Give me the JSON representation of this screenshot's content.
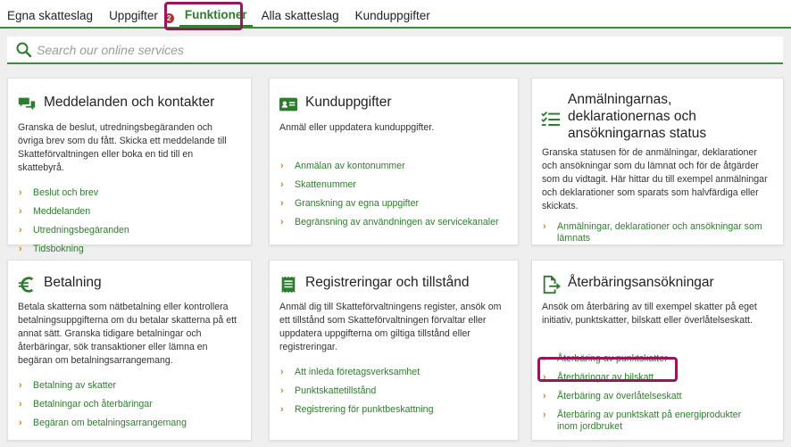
{
  "tabs": [
    {
      "label": "Egna skatteslag"
    },
    {
      "label": "Uppgifter",
      "badge": "2"
    },
    {
      "label": "Funktioner"
    },
    {
      "label": "Alla skatteslag"
    },
    {
      "label": "Kunduppgifter"
    }
  ],
  "search": {
    "placeholder": "Search our online services"
  },
  "colors": {
    "accent": "#2e7d2e",
    "chevron": "#e07b1a",
    "highlight": "#9a1559",
    "badge": "#c0282d"
  },
  "cards": [
    {
      "icon": "chat-bubbles-icon",
      "title": "Meddelanden och kontakter",
      "desc": "Granska de beslut, utredningsbegäranden och övriga brev som du fått. Skicka ett meddelande till Skatteförvaltningen eller boka en tid till en skattebyrå.",
      "links": [
        "Beslut och brev",
        "Meddelanden",
        "Utredningsbegäranden",
        "Tidsbokning"
      ]
    },
    {
      "icon": "id-card-icon",
      "title": "Kunduppgifter",
      "desc": "Anmäl eller uppdatera kunduppgifter.",
      "links": [
        "Anmälan av kontonummer",
        "Skattenummer",
        "Granskning av egna uppgifter",
        "Begränsning av användningen av servicekanaler"
      ]
    },
    {
      "icon": "checklist-icon",
      "title": "Anmälningarnas, deklarationernas och ansökningarnas status",
      "desc": "Granska statusen för de anmälningar, deklarationer och ansökningar som du lämnat och för de åtgärder som du vidtagit. Här hittar du till exempel anmälningar och deklarationer som sparats som halvfärdiga eller skickats.",
      "links": [
        "Anmälningar, deklarationer och ansökningar som lämnats"
      ]
    },
    {
      "icon": "euro-icon",
      "title": "Betalning",
      "desc": "Betala skatterna som nätbetalning eller kontrollera betalningsuppgifterna om du betalar skatterna på ett annat sätt. Granska tidigare betalningar och återbäringar, sök transaktioner eller lämna en begäran om betalningsarrangemang.",
      "links": [
        "Betalning av skatter",
        "Betalningar och återbäringar",
        "Begäran om betalningsarrangemang"
      ]
    },
    {
      "icon": "receipt-icon",
      "title": "Registreringar och tillstånd",
      "desc": "Anmäl dig till Skatteförvaltningens register, ansök om ett tillstånd som Skatteförvaltningen förvaltar eller uppdatera uppgifterna om giltiga tillstånd eller registreringar.",
      "links": [
        "Att inleda företagsverksamhet",
        "Punktskattetillstånd",
        "Registrering för punktbeskattning"
      ]
    },
    {
      "icon": "document-export-icon",
      "title": "Återbäringsansökningar",
      "desc": "Ansök om återbäring av till exempel skatter på eget initiativ, punktskatter, bilskatt eller överlåtelseskatt.",
      "links": [
        "Återbäring av punktskatter",
        "Återbäringar av bilskatt",
        "Återbäring av överlåtelseskatt",
        "Återbäring av punktskatt på energiprodukter inom jordbruket"
      ]
    }
  ]
}
